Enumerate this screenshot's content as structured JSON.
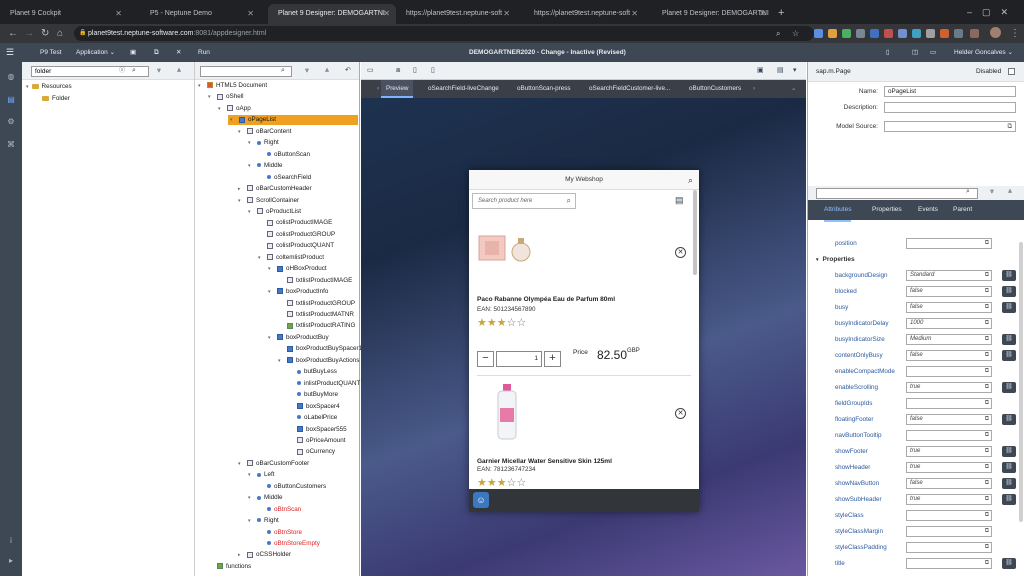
{
  "browser": {
    "tabs": [
      {
        "label": "Planet 9 Cockpit",
        "active": false
      },
      {
        "label": "P5 - Neptune Demo",
        "active": false
      },
      {
        "label": "Planet 9 Designer: DEMOGARTNI",
        "active": true
      },
      {
        "label": "https://planet9test.neptune-soft",
        "active": false
      },
      {
        "label": "https://planet9test.neptune-soft",
        "active": false
      },
      {
        "label": "Planet 9 Designer: DEMOGARTNI",
        "active": false
      }
    ],
    "url_host": "planet9test.neptune-software.com",
    "url_path": ":8081/appdesigner.html"
  },
  "app_header": {
    "project": "P9 Test",
    "application": "Application",
    "run": "Run",
    "title": "DEMOGARTNER2020 - Change - Inactive (Revised)",
    "user": "Helder Goncalves"
  },
  "resources": {
    "search_value": "folder",
    "items": [
      {
        "label": "Resources"
      },
      {
        "label": "Folder"
      }
    ]
  },
  "tree": {
    "items": [
      {
        "label": "HTML5 Document",
        "indent": 0,
        "icon": "document-icon",
        "arrow": "▾"
      },
      {
        "label": "oShell",
        "indent": 1,
        "icon": "shell-icon",
        "arrow": "▾"
      },
      {
        "label": "oApp",
        "indent": 2,
        "icon": "app-icon",
        "arrow": "▾"
      },
      {
        "label": "oPageList",
        "indent": 3,
        "icon": "page-icon",
        "arrow": "▾",
        "selected": true
      },
      {
        "label": "oBarContent",
        "indent": 4,
        "icon": "bar-icon",
        "arrow": "▾"
      },
      {
        "label": "Right",
        "indent": 5,
        "icon": "aggregation-icon",
        "arrow": "▾"
      },
      {
        "label": "oButtonScan",
        "indent": 6,
        "icon": "button-icon",
        "arrow": ""
      },
      {
        "label": "Middle",
        "indent": 5,
        "icon": "aggregation-icon",
        "arrow": "▾"
      },
      {
        "label": "oSearchField",
        "indent": 6,
        "icon": "searchfield-icon",
        "arrow": ""
      },
      {
        "label": "oBarCustomHeader",
        "indent": 4,
        "icon": "bar-icon",
        "arrow": "▸"
      },
      {
        "label": "ScrollContainer",
        "indent": 4,
        "icon": "container-icon",
        "arrow": "▾"
      },
      {
        "label": "oProductList",
        "indent": 5,
        "icon": "list-icon",
        "arrow": "▾"
      },
      {
        "label": "colistProductIMAGE",
        "indent": 6,
        "icon": "column-icon",
        "arrow": ""
      },
      {
        "label": "colistProductGROUP",
        "indent": 6,
        "icon": "column-icon",
        "arrow": ""
      },
      {
        "label": "colistProductQUANT",
        "indent": 6,
        "icon": "column-icon",
        "arrow": ""
      },
      {
        "label": "coltemlistProduct",
        "indent": 6,
        "icon": "column-icon",
        "arrow": "▾"
      },
      {
        "label": "oHBoxProduct",
        "indent": 7,
        "icon": "hbox-icon",
        "arrow": "▾"
      },
      {
        "label": "txtlistProductIMAGE",
        "indent": 8,
        "icon": "image-icon",
        "arrow": ""
      },
      {
        "label": "boxProductInfo",
        "indent": 7,
        "icon": "vbox-icon",
        "arrow": "▾"
      },
      {
        "label": "txtlistProductGROUP",
        "indent": 8,
        "icon": "text-icon",
        "arrow": ""
      },
      {
        "label": "txtlistProductMATNR",
        "indent": 8,
        "icon": "text-icon",
        "arrow": ""
      },
      {
        "label": "txtlistProductRATING",
        "indent": 8,
        "icon": "rating-icon",
        "arrow": ""
      },
      {
        "label": "boxProductBuy",
        "indent": 7,
        "icon": "vbox-icon",
        "arrow": "▾"
      },
      {
        "label": "boxProductBuySpacer1",
        "indent": 8,
        "icon": "hbox-icon",
        "arrow": ""
      },
      {
        "label": "boxProductBuyActions",
        "indent": 8,
        "icon": "hbox-icon",
        "arrow": "▾"
      },
      {
        "label": "butBuyLess",
        "indent": 9,
        "icon": "button-icon",
        "arrow": ""
      },
      {
        "label": "inlistProductQUANT",
        "indent": 9,
        "icon": "input-icon",
        "arrow": ""
      },
      {
        "label": "butBuyMore",
        "indent": 9,
        "icon": "button-icon",
        "arrow": ""
      },
      {
        "label": "boxSpacer4",
        "indent": 9,
        "icon": "hbox-icon",
        "arrow": ""
      },
      {
        "label": "oLabelPrice",
        "indent": 9,
        "icon": "label-icon",
        "arrow": ""
      },
      {
        "label": "boxSpacer555",
        "indent": 9,
        "icon": "hbox-icon",
        "arrow": ""
      },
      {
        "label": "oPriceAmount",
        "indent": 9,
        "icon": "text-icon",
        "arrow": ""
      },
      {
        "label": "oCurrency",
        "indent": 9,
        "icon": "text-icon",
        "arrow": ""
      },
      {
        "label": "oBarCustomFooter",
        "indent": 4,
        "icon": "bar-icon",
        "arrow": "▾"
      },
      {
        "label": "Left",
        "indent": 5,
        "icon": "aggregation-icon",
        "arrow": "▾"
      },
      {
        "label": "oButtonCustomers",
        "indent": 6,
        "icon": "button-icon",
        "arrow": ""
      },
      {
        "label": "Middle",
        "indent": 5,
        "icon": "aggregation-icon",
        "arrow": "▾"
      },
      {
        "label": "oBtnScan",
        "indent": 6,
        "icon": "button-icon",
        "arrow": "",
        "red": true
      },
      {
        "label": "Right",
        "indent": 5,
        "icon": "aggregation-icon",
        "arrow": "▾"
      },
      {
        "label": "oBtnStore",
        "indent": 6,
        "icon": "button-icon",
        "arrow": "",
        "red": true
      },
      {
        "label": "oBtnStoreEmpty",
        "indent": 6,
        "icon": "button-icon",
        "arrow": "",
        "red": true
      },
      {
        "label": "oCSSHolder",
        "indent": 4,
        "icon": "css-icon",
        "arrow": "▸"
      },
      {
        "label": "functions",
        "indent": 1,
        "icon": "functions-icon",
        "arrow": ""
      }
    ]
  },
  "editor_tabs": [
    "Preview",
    "oSearchField-liveChange",
    "oButtonScan-press",
    "oSearchFieldCustomer-live...",
    "oButtonCustomers"
  ],
  "phone": {
    "title": "My Webshop",
    "search_placeholder": "Search product here",
    "products": [
      {
        "name": "Paco Rabanne Olympéa Eau de Parfum 80ml",
        "ean": "EAN: 501234567890",
        "rating": 3,
        "max_rating": 5,
        "quantity": "1",
        "price_label": "Price",
        "price": "82.50",
        "currency": "GBP"
      },
      {
        "name": "Garnier Micellar Water Sensitive Skin 125ml",
        "ean": "EAN: 781236747234",
        "rating": 3,
        "max_rating": 5
      }
    ]
  },
  "props": {
    "type": "sap.m.Page",
    "disabled_label": "Disabled",
    "name_label": "Name:",
    "name_value": "oPageList",
    "description_label": "Description:",
    "description_value": "",
    "model_label": "Model Source:",
    "model_value": "",
    "tabs": [
      "Attributes",
      "Properties",
      "Events",
      "Parent"
    ],
    "section_label": "Properties",
    "rows": [
      {
        "label": "position",
        "value": ""
      },
      {
        "label": "backgroundDesign",
        "value": "Standard",
        "bind": true
      },
      {
        "label": "blocked",
        "value": "false",
        "bind": true
      },
      {
        "label": "busy",
        "value": "false",
        "bind": true
      },
      {
        "label": "busyIndicatorDelay",
        "value": "1000"
      },
      {
        "label": "busyIndicatorSize",
        "value": "Medium",
        "bind": true
      },
      {
        "label": "contentOnlyBusy",
        "value": "false",
        "bind": true
      },
      {
        "label": "enableCompactMode",
        "value": ""
      },
      {
        "label": "enableScrolling",
        "value": "true",
        "bind": true
      },
      {
        "label": "fieldGroupIds",
        "value": ""
      },
      {
        "label": "floatingFooter",
        "value": "false",
        "bind": true
      },
      {
        "label": "navButtonTooltip",
        "value": ""
      },
      {
        "label": "showFooter",
        "value": "true",
        "bind": true
      },
      {
        "label": "showHeader",
        "value": "true",
        "bind": true
      },
      {
        "label": "showNavButton",
        "value": "false",
        "bind": true
      },
      {
        "label": "showSubHeader",
        "value": "true",
        "bind": true
      },
      {
        "label": "styleClass",
        "value": ""
      },
      {
        "label": "styleClassMargin",
        "value": ""
      },
      {
        "label": "styleClassPadding",
        "value": ""
      },
      {
        "label": "title",
        "value": "",
        "bind": true
      }
    ]
  }
}
